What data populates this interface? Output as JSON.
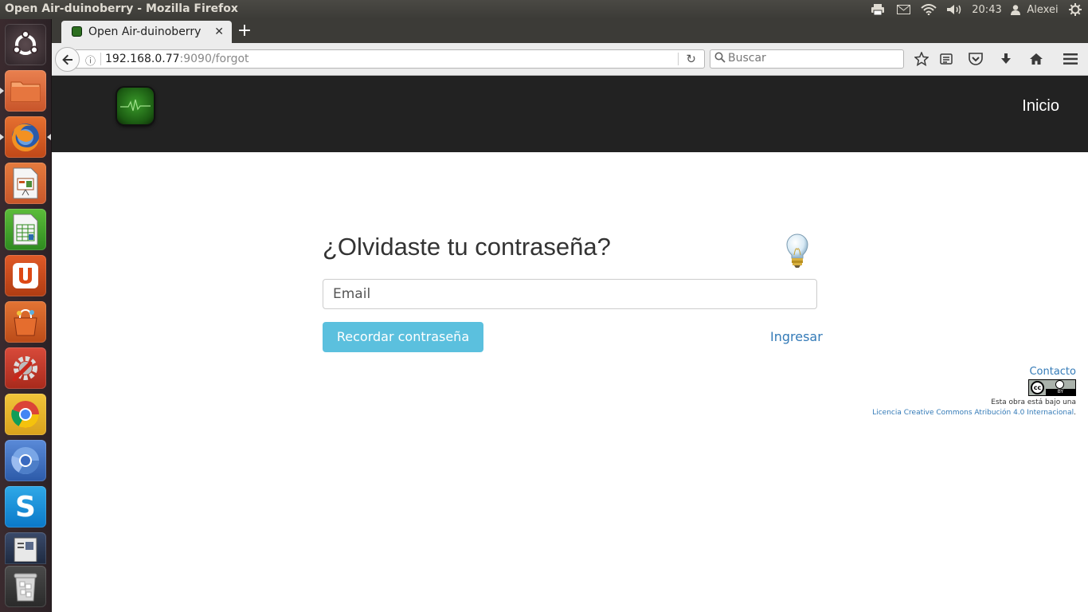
{
  "window": {
    "title": "Open Air-duinoberry - Mozilla Firefox"
  },
  "system_indicators": {
    "clock": "20:43",
    "user": "Alexei"
  },
  "launcher": {
    "items": [
      "ubuntu-dash",
      "files",
      "firefox",
      "libreoffice-impress",
      "libreoffice-calc",
      "ubuntu-one",
      "software-center",
      "system-settings",
      "google-chrome",
      "chromium",
      "skype",
      "document-viewer",
      "trash"
    ]
  },
  "browser": {
    "tab_label": "Open Air-duinoberry",
    "url_host": "192.168.0.77",
    "url_rest": ":9090/forgot",
    "search_placeholder": "Buscar"
  },
  "page": {
    "nav_home": "Inicio",
    "heading": "¿Olvidaste tu contraseña?",
    "email_placeholder": "Email",
    "remind_button": "Recordar contraseña",
    "login_link": "Ingresar",
    "contact_link": "Contacto",
    "license_badge_cc": "cc",
    "license_badge_by": "BY",
    "license_text": "Esta obra está bajo una",
    "license_link": "Licencia Creative Commons Atribución 4.0 Internacional",
    "license_period": "."
  },
  "colors": {
    "site_nav_bg": "#222222",
    "button_info": "#5bc0de",
    "link": "#337ab7",
    "launcher_bg": "#3a2a2e"
  }
}
